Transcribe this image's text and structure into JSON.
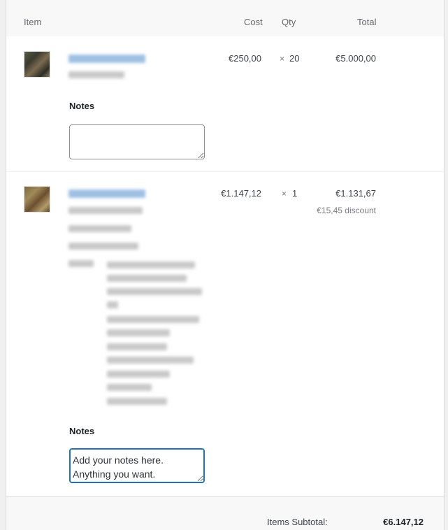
{
  "table": {
    "headers": {
      "item": "Item",
      "cost": "Cost",
      "qty": "Qty",
      "total": "Total"
    }
  },
  "items": [
    {
      "cost": "€250,00",
      "qty_prefix": "×",
      "qty": "20",
      "total": "€5.000,00",
      "notes_label": "Notes",
      "notes_value": ""
    },
    {
      "cost": "€1.147,12",
      "qty_prefix": "×",
      "qty": "1",
      "total": "€1.131,67",
      "discount": "€15,45 discount",
      "notes_label": "Notes",
      "notes_value": "Add your notes here.\nAnything you want."
    }
  ],
  "footer": {
    "subtotal_label": "Items Subtotal:",
    "subtotal_value": "€6.147,12"
  }
}
